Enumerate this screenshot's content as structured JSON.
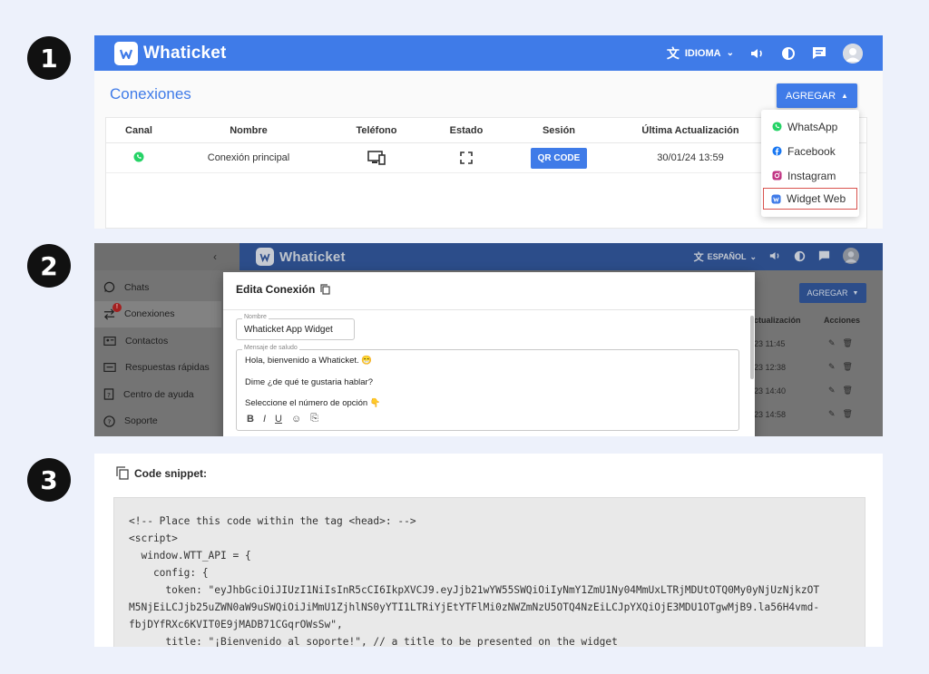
{
  "steps": [
    "1",
    "2",
    "3"
  ],
  "panel1": {
    "app_name": "Whaticket",
    "language_label": "IDIOMA",
    "page_title": "Conexiones",
    "add_button": "AGREGAR",
    "columns": [
      "Canal",
      "Nombre",
      "Teléfono",
      "Estado",
      "Sesión",
      "Última Actualización"
    ],
    "row": {
      "name": "Conexión principal",
      "session_button": "QR CODE",
      "updated": "30/01/24 13:59"
    },
    "dropdown": [
      {
        "label": "WhatsApp",
        "icon": "whatsapp-icon",
        "color": "#25d366"
      },
      {
        "label": "Facebook",
        "icon": "facebook-icon",
        "color": "#1877f2"
      },
      {
        "label": "Instagram",
        "icon": "instagram-icon",
        "color": "#c13584"
      },
      {
        "label": "Widget Web",
        "icon": "widget-icon",
        "color": "#3f7be8",
        "highlighted": true
      }
    ],
    "colors": {
      "primary": "#3f7be8",
      "highlight": "#d9534f"
    }
  },
  "panel2": {
    "app_name": "Whaticket",
    "language_label": "ESPAÑOL",
    "sidebar": [
      {
        "label": "Chats",
        "icon": "whatsapp-icon"
      },
      {
        "label": "Conexiones",
        "icon": "swap-arrows-icon",
        "badge": "!"
      },
      {
        "label": "Contactos",
        "icon": "contacts-icon"
      },
      {
        "label": "Respuestas rápidas",
        "icon": "message-icon"
      },
      {
        "label": "Centro de ayuda",
        "icon": "help-icon"
      },
      {
        "label": "Soporte",
        "icon": "question-icon"
      }
    ],
    "add_button": "AGREGAR",
    "bg_columns": [
      "ctualización",
      "Acciones"
    ],
    "bg_rows": [
      "23 11:45",
      "23 12:38",
      "23 14:40",
      "23 14:58"
    ],
    "modal": {
      "title": "Edita Conexión",
      "name_label": "Nombre",
      "name_value": "Whaticket App Widget",
      "greeting_label": "Mensaje de saludo",
      "greeting_lines": [
        "Hola, bienvenido a Whaticket. 😁",
        "Dime ¿de qué te gustaria hablar?",
        "Seleccione el número de opción 👇"
      ],
      "toolbar": [
        "B",
        "I",
        "U"
      ]
    }
  },
  "panel3": {
    "title": "Code snippet:",
    "code_lines": [
      "<!-- Place this code within the tag <head>: -->",
      "<script>",
      "  window.WTT_API = {",
      "    config: {",
      "      token: \"eyJhbGciOiJIUzI1NiIsInR5cCI6IkpXVCJ9.eyJjb21wYW55SWQiOiIyNmY1ZmU1Ny04MmUxLTRjMDUtOTQ0My0yNjUzNjkzOT",
      "M5NjEiLCJjb25uZWN0aW9uSWQiOiJiMmU1ZjhlNS0yYTI1LTRiYjEtYTFlMi0zNWZmNzU5OTQ4NzEiLCJpYXQiOjE3MDU1OTgwMjB9.la56H4vmd-",
      "fbjDYfRXc6KVIT0E9jMADB71CGqrOWsSw\",",
      "      title: \"¡Bienvenido al soporte!\", // a title to be presented on the widget"
    ]
  }
}
